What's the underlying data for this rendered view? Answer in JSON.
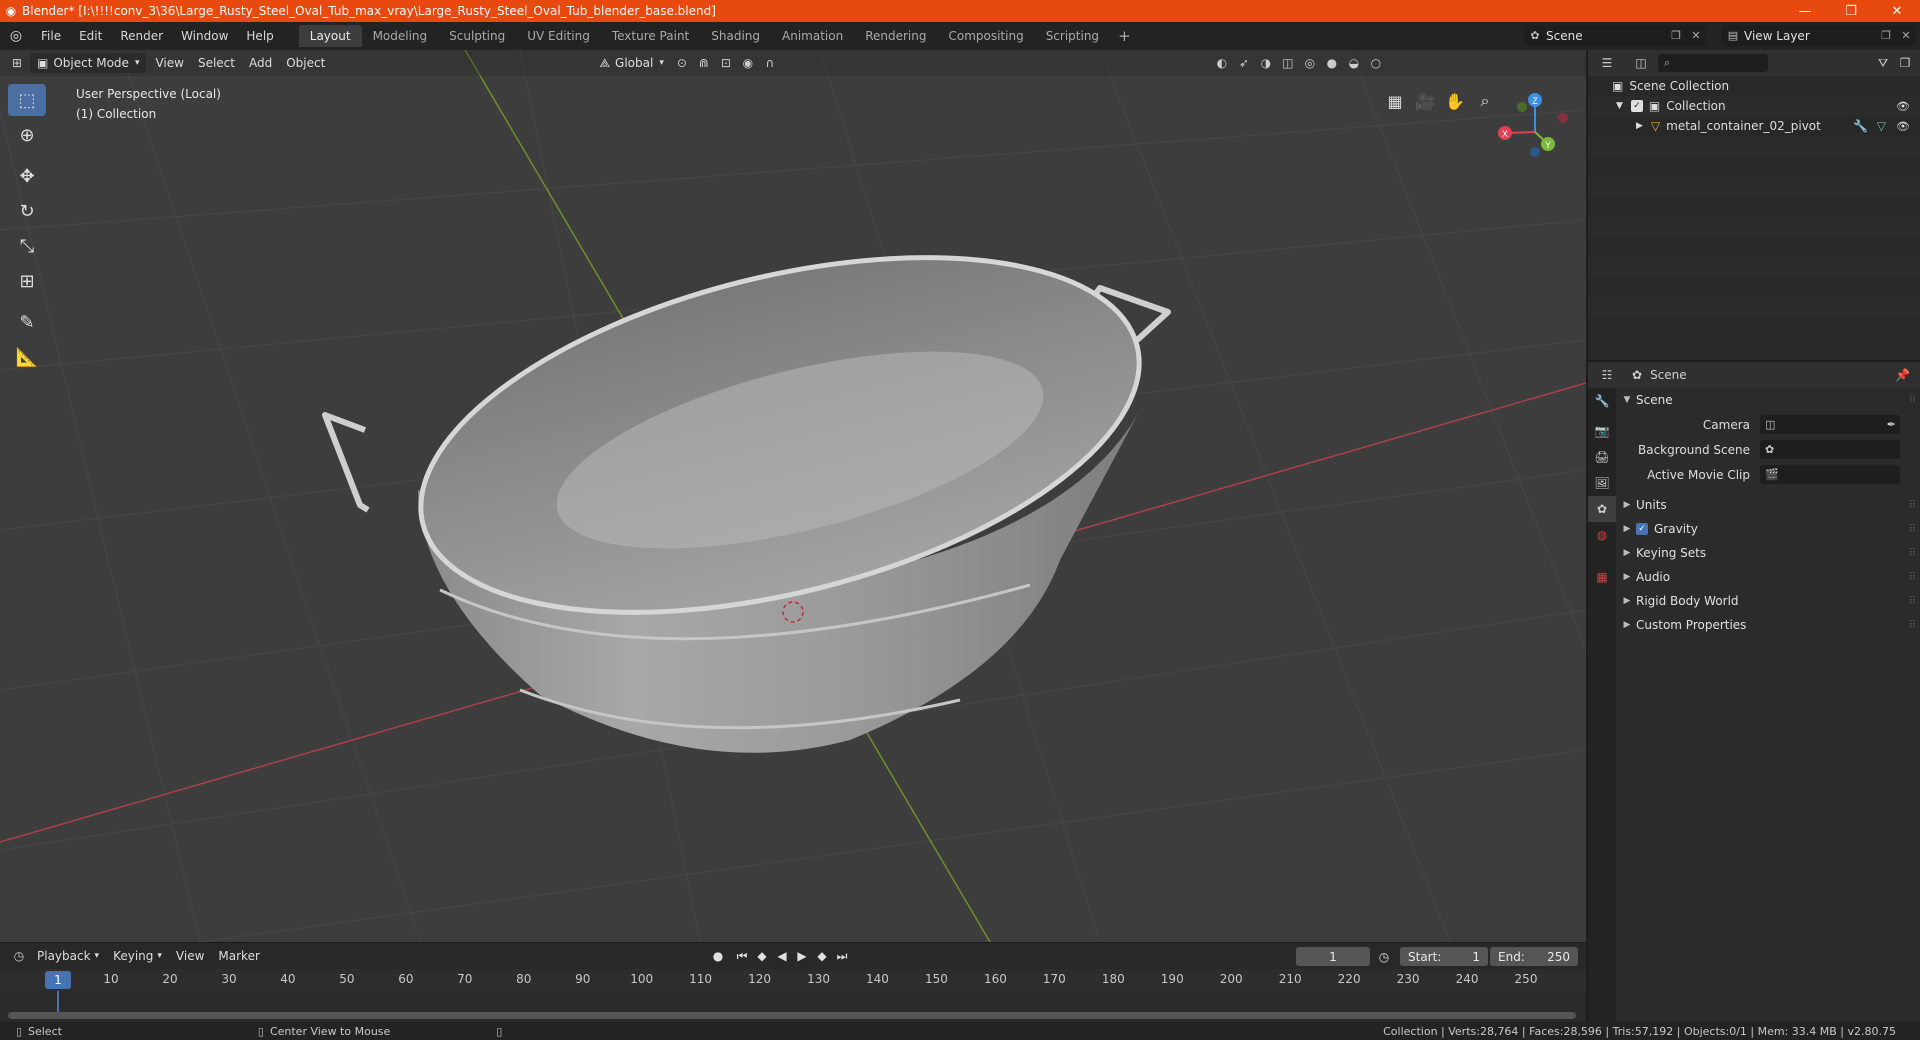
{
  "window": {
    "title": "Blender* [I:\\!!!!conv_3\\36\\Large_Rusty_Steel_Oval_Tub_max_vray\\Large_Rusty_Steel_Oval_Tub_blender_base.blend]",
    "minimize": "—",
    "maximize": "❐",
    "close": "✕"
  },
  "menu": [
    "File",
    "Edit",
    "Render",
    "Window",
    "Help"
  ],
  "workspaces": [
    "Layout",
    "Modeling",
    "Sculpting",
    "UV Editing",
    "Texture Paint",
    "Shading",
    "Animation",
    "Rendering",
    "Compositing",
    "Scripting"
  ],
  "active_workspace": "Layout",
  "scene_selector": {
    "value": "Scene"
  },
  "view_layer_selector": {
    "value": "View Layer"
  },
  "viewport": {
    "mode": "Object Mode",
    "menus": [
      "View",
      "Select",
      "Add",
      "Object"
    ],
    "transform_orientation": "Global",
    "info_line1": "User Perspective (Local)",
    "info_line2": "(1) Collection",
    "gizmo_axes": {
      "x": "X",
      "y": "Y",
      "z": "Z"
    }
  },
  "timeline": {
    "menus": [
      "Playback",
      "Keying",
      "View",
      "Marker"
    ],
    "current_frame": "1",
    "start_label": "Start:",
    "start_value": "1",
    "end_label": "End:",
    "end_value": "250",
    "ruler_current": "1",
    "ticks": [
      "10",
      "20",
      "30",
      "40",
      "50",
      "60",
      "70",
      "80",
      "90",
      "100",
      "110",
      "120",
      "130",
      "140",
      "150",
      "160",
      "170",
      "180",
      "190",
      "200",
      "210",
      "220",
      "230",
      "240",
      "250"
    ]
  },
  "statusbar": {
    "select": "Select",
    "center_view": "Center View to Mouse",
    "stats": "Collection | Verts:28,764 | Faces:28,596 | Tris:57,192 | Objects:0/1 | Mem: 33.4 MB | v2.80.75"
  },
  "outliner": {
    "scene_collection": "Scene Collection",
    "collection": "Collection",
    "object": "metal_container_02_pivot"
  },
  "properties": {
    "header_title": "Scene",
    "scene_panel": "Scene",
    "camera_label": "Camera",
    "background_scene_label": "Background Scene",
    "active_movie_clip_label": "Active Movie Clip",
    "panels": {
      "units": "Units",
      "gravity": "Gravity",
      "keying_sets": "Keying Sets",
      "audio": "Audio",
      "rigid_body_world": "Rigid Body World",
      "custom_properties": "Custom Properties"
    }
  },
  "colors": {
    "title_bar": "#e8490f",
    "active_tool": "#4b6fa3",
    "axis_x": "#e04050",
    "axis_y": "#7cb83a",
    "axis_z": "#3b8fe0",
    "current_frame": "#4772b3"
  }
}
